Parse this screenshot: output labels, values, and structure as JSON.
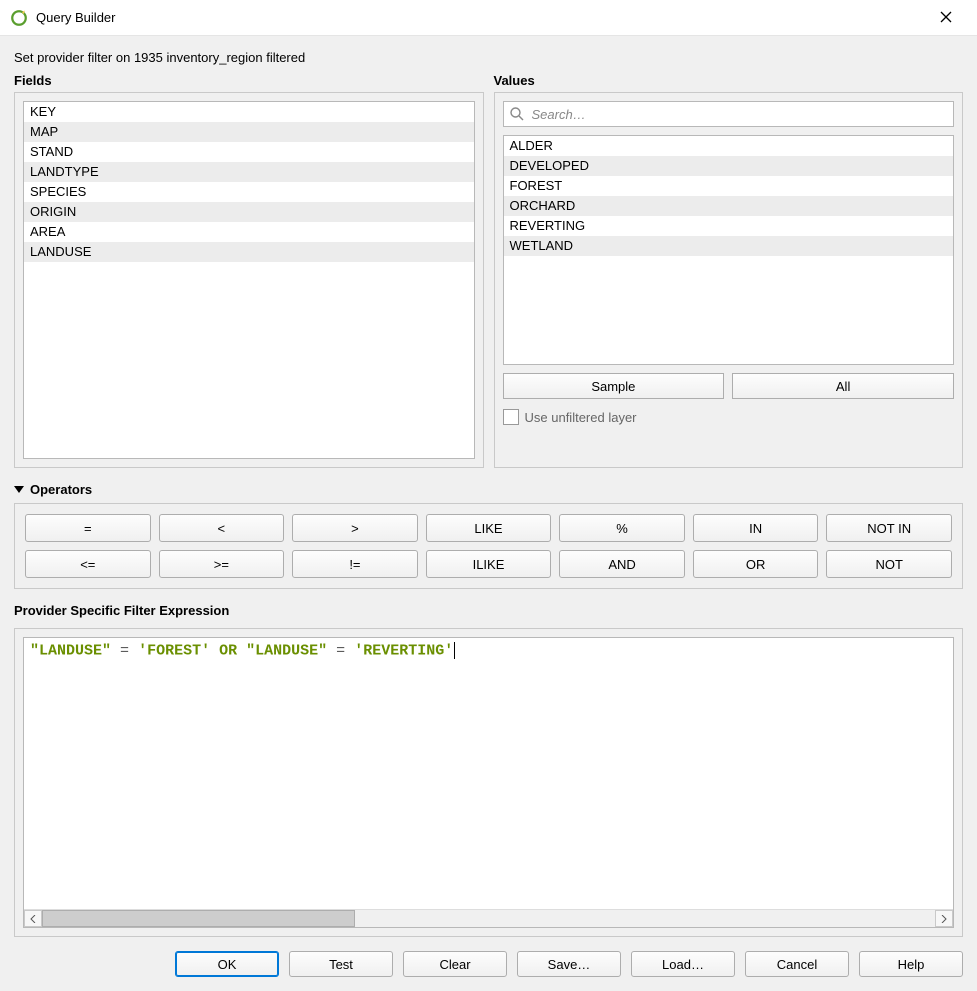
{
  "title": "Query Builder",
  "subtitle": "Set provider filter on 1935 inventory_region filtered",
  "fields_label": "Fields",
  "values_label": "Values",
  "fields": [
    "KEY",
    "MAP",
    "STAND",
    "LANDTYPE",
    "SPECIES",
    "ORIGIN",
    "AREA",
    "LANDUSE"
  ],
  "search_placeholder": "Search…",
  "values": [
    "ALDER",
    "DEVELOPED",
    "FOREST",
    "ORCHARD",
    "REVERTING",
    "WETLAND"
  ],
  "sample_label": "Sample",
  "all_label": "All",
  "unfiltered_label": "Use unfiltered layer",
  "operators_label": "Operators",
  "operators": [
    "=",
    "<",
    ">",
    "LIKE",
    "%",
    "IN",
    "NOT IN",
    "<=",
    ">=",
    "!=",
    "ILIKE",
    "AND",
    "OR",
    "NOT"
  ],
  "expr_section_label": "Provider Specific Filter Expression",
  "expression_tokens": [
    {
      "t": "field",
      "v": "\"LANDUSE\""
    },
    {
      "t": "sp",
      "v": " "
    },
    {
      "t": "op",
      "v": "="
    },
    {
      "t": "sp",
      "v": " "
    },
    {
      "t": "str",
      "v": "'FOREST'"
    },
    {
      "t": "sp",
      "v": " "
    },
    {
      "t": "kw",
      "v": "OR"
    },
    {
      "t": "sp",
      "v": " "
    },
    {
      "t": "field",
      "v": "\"LANDUSE\""
    },
    {
      "t": "sp",
      "v": " "
    },
    {
      "t": "op",
      "v": "="
    },
    {
      "t": "sp",
      "v": " "
    },
    {
      "t": "str",
      "v": "'REVERTING'"
    }
  ],
  "buttons": {
    "ok": "OK",
    "test": "Test",
    "clear": "Clear",
    "save": "Save…",
    "load": "Load…",
    "cancel": "Cancel",
    "help": "Help"
  }
}
